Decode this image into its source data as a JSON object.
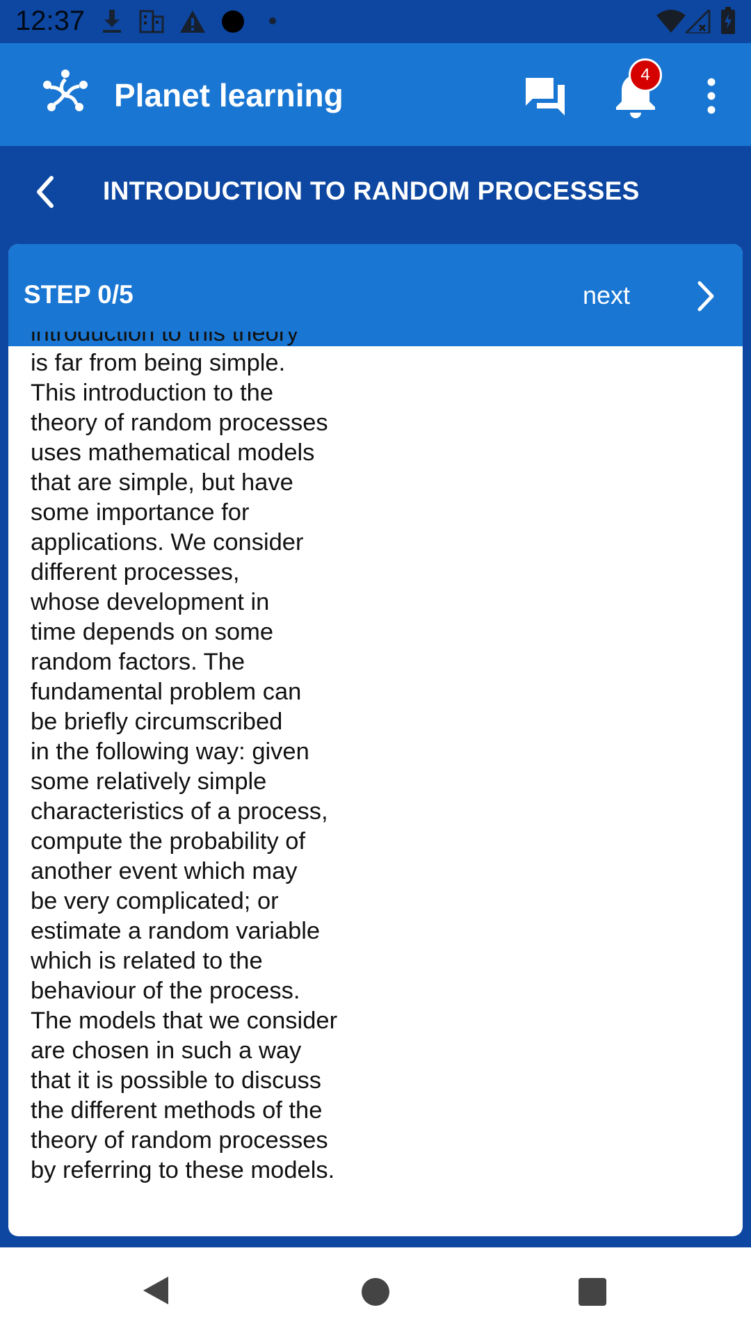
{
  "status_bar": {
    "time": "12:37",
    "icons": [
      "download-icon",
      "building-icon",
      "warning-icon",
      "circle-icon",
      "dot-icon",
      "wifi-icon",
      "signal-icon",
      "battery-icon"
    ]
  },
  "app_bar": {
    "title": "Planet learning",
    "notification_count": "4",
    "icons": [
      "logo-icon",
      "chat-icon",
      "bell-icon",
      "more-vert-icon"
    ]
  },
  "header": {
    "title": "INTRODUCTION TO RANDOM PROCESSES"
  },
  "step": {
    "label": "STEP 0/5",
    "next_label": "next",
    "partial_first_line": "introduction to this theory",
    "lines": [
      "is far from being simple.",
      "This introduction to the",
      "theory of random processes",
      "uses mathematical models",
      "that are simple, but have",
      "some importance for",
      "applications. We consider",
      "different processes,",
      "whose development in",
      "time depends on some",
      "random factors. The",
      "fundamental problem can",
      "be briefly circumscribed",
      "in the following way: given",
      "some relatively simple",
      "characteristics of a process,",
      "compute the probability of",
      "another event which may",
      "be very complicated; or",
      "estimate a random variable",
      "which is related to the",
      "behaviour of the process.",
      "The models that we consider",
      "are chosen in such a way",
      "that it is possible to discuss",
      "the different methods of the",
      "theory of random processes",
      "by referring to these models."
    ]
  },
  "nav_bar": {
    "icons": [
      "back-triangle-icon",
      "home-circle-icon",
      "recents-square-icon"
    ]
  },
  "colors": {
    "primary": "#1976d2",
    "primary_dark": "#0d47a1",
    "badge": "#d50000"
  }
}
